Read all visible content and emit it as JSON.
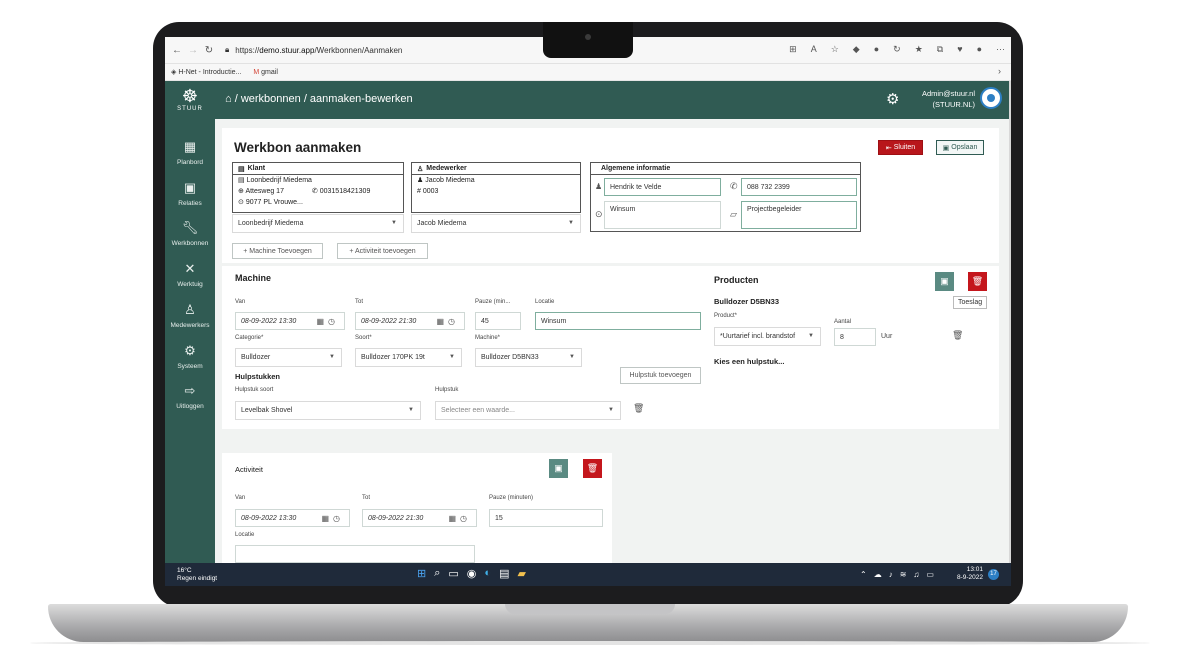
{
  "browser": {
    "url_prefix": "https://",
    "url_host": "demo.stuur.app",
    "url_path": "/Werkbonnen/Aanmaken",
    "bookmarks": [
      "H-Net - Introductie...",
      "gmail"
    ]
  },
  "app": {
    "logo_text": "STUUR",
    "breadcrumb": "/ werkbonnen / aanmaken-bewerken",
    "admin_email": "Admin@stuur.nl",
    "admin_org": "(STUUR.NL)",
    "accent_color": "#305b53",
    "danger_color": "#b8161b"
  },
  "sidebar": {
    "items": [
      {
        "label": "Planbord",
        "icon": "calendar-icon"
      },
      {
        "label": "Relaties",
        "icon": "contact-card-icon"
      },
      {
        "label": "Werkbonnen",
        "icon": "wrench-icon"
      },
      {
        "label": "Werktuig",
        "icon": "tools-icon"
      },
      {
        "label": "Medewerkers",
        "icon": "person-icon"
      },
      {
        "label": "Systeem",
        "icon": "gear-icon"
      },
      {
        "label": "Uitloggen",
        "icon": "logout-icon"
      }
    ]
  },
  "form": {
    "title": "Werkbon aanmaken",
    "close_label": "Sluiten",
    "save_label": "Opslaan",
    "klant": {
      "heading": "Klant",
      "name": "Loonbedrijf Miedema",
      "street": "Attesweg 17",
      "phone": "0031518421309",
      "postal": "9077 PL Vrouwe...",
      "select_value": "Loonbedrijf Miedema"
    },
    "medewerker": {
      "heading": "Medewerker",
      "name": "Jacob Miedema",
      "number": "# 0003",
      "select_value": "Jacob Miedema"
    },
    "algemeen": {
      "heading": "Algemene informatie",
      "contact": "Hendrik te Velde",
      "phone": "088 732 2399",
      "location": "Winsum",
      "role": "Projectbegeleider"
    },
    "add_machine_label": "+ Machine Toevoegen",
    "add_activity_label": "+ Activiteit toevoegen"
  },
  "machine": {
    "heading": "Machine",
    "van_label": "Van",
    "van_value": "08-09-2022 13:30",
    "tot_label": "Tot",
    "tot_value": "08-09-2022 21:30",
    "pauze_label": "Pauze (min...",
    "pauze_value": "45",
    "locatie_label": "Locatie",
    "locatie_value": "Winsum",
    "categorie_label": "Categorie*",
    "categorie_value": "Bulldozer",
    "soort_label": "Soort*",
    "soort_value": "Bulldozer 170PK 19t",
    "machine_label": "Machine*",
    "machine_value": "Bulldozer D5BN33",
    "hulpstukken_heading": "Hulpstukken",
    "hulpstuk_soort_label": "Hulpstuk soort",
    "hulpstuk_soort_value": "Levelbak Shovel",
    "hulpstuk_label": "Hulpstuk",
    "hulpstuk_placeholder": "Selecteer een waarde...",
    "add_hulpstuk_label": "Hulpstuk toevoegen"
  },
  "producten": {
    "heading": "Producten",
    "machine_name": "Bulldozer D5BN33",
    "tooltip": "Toeslag",
    "product_label": "Product*",
    "product_value": "*Uurtarief incl. brandstof",
    "aantal_label": "Aantal",
    "aantal_value": "8",
    "unit": "Uur",
    "hulpstuk_prompt": "Kies een hulpstuk..."
  },
  "activiteit": {
    "heading": "Activiteit",
    "van_label": "Van",
    "van_value": "08-09-2022 13:30",
    "tot_label": "Tot",
    "tot_value": "08-09-2022 21:30",
    "pauze_label": "Pauze (minuten)",
    "pauze_value": "15",
    "locatie_label": "Locatie"
  },
  "taskbar": {
    "temperature": "16°C",
    "weather": "Regen eindigt",
    "time": "13:01",
    "date": "8-9-2022",
    "notifications": "17"
  }
}
